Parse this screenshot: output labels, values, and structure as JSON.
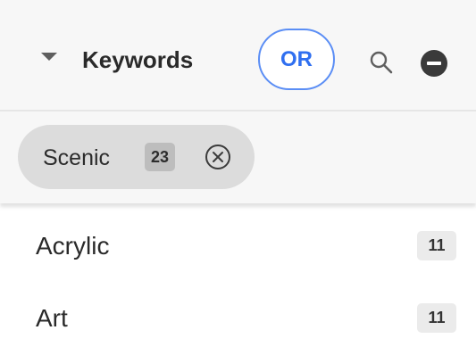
{
  "header": {
    "title": "Keywords",
    "or_label": "OR",
    "icons": {
      "caret": "caret-down-icon",
      "search": "search-icon",
      "remove": "minus-circle-icon"
    }
  },
  "filter": {
    "chip": {
      "label": "Scenic",
      "count": "23",
      "close_icon": "close-circle-icon"
    }
  },
  "list": [
    {
      "label": "Acrylic",
      "count": "11"
    },
    {
      "label": "Art",
      "count": "11"
    }
  ],
  "colors": {
    "accent": "#2f6ff0",
    "accent_border": "#5b8ef5",
    "header_bg": "#f7f7f7",
    "chip_bg": "#dcdcdc",
    "badge_bg": "#ebebeb"
  }
}
